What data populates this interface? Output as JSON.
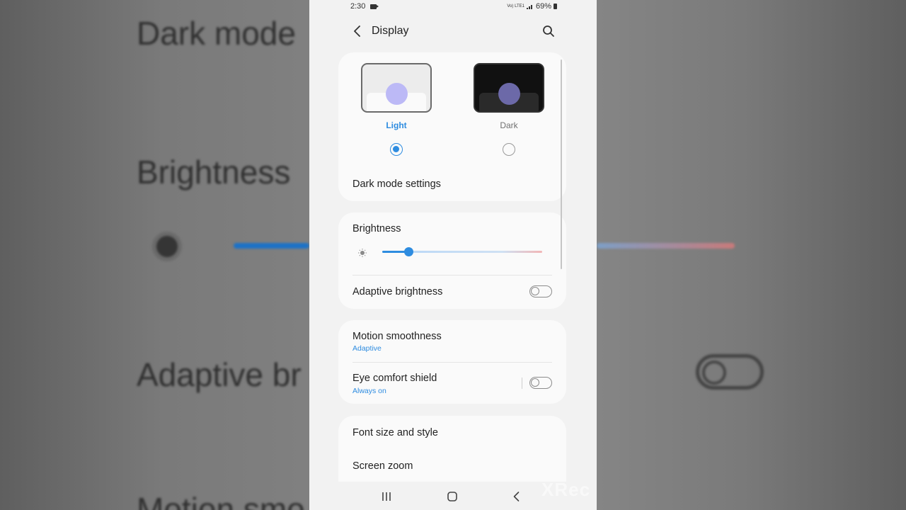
{
  "status_bar": {
    "time": "2:30",
    "battery": "69%",
    "signal_label": "Vo) LTE1"
  },
  "header": {
    "title": "Display"
  },
  "theme": {
    "options": [
      {
        "label": "Light",
        "selected": true
      },
      {
        "label": "Dark",
        "selected": false
      }
    ],
    "dark_mode_settings_label": "Dark mode settings"
  },
  "brightness": {
    "label": "Brightness",
    "level": 0.16,
    "adaptive_label": "Adaptive brightness",
    "adaptive_on": false
  },
  "motion": {
    "label": "Motion smoothness",
    "value": "Adaptive"
  },
  "eye_comfort": {
    "label": "Eye comfort shield",
    "value": "Always on",
    "on": false
  },
  "more": {
    "font_label": "Font size and style",
    "zoom_label": "Screen zoom"
  },
  "background": {
    "dark_mode": "Dark mode",
    "brightness": "Brightness",
    "adaptive": "Adaptive br",
    "motion": "Motion smo"
  },
  "watermark": "XRec",
  "colors": {
    "accent": "#2e8ce0",
    "card": "#fafafa",
    "screen_bg": "#f2f2f2"
  },
  "icons": [
    "back-arrow-icon",
    "search-icon",
    "sun-icon",
    "recents-icon",
    "home-icon",
    "back-nav-icon"
  ]
}
